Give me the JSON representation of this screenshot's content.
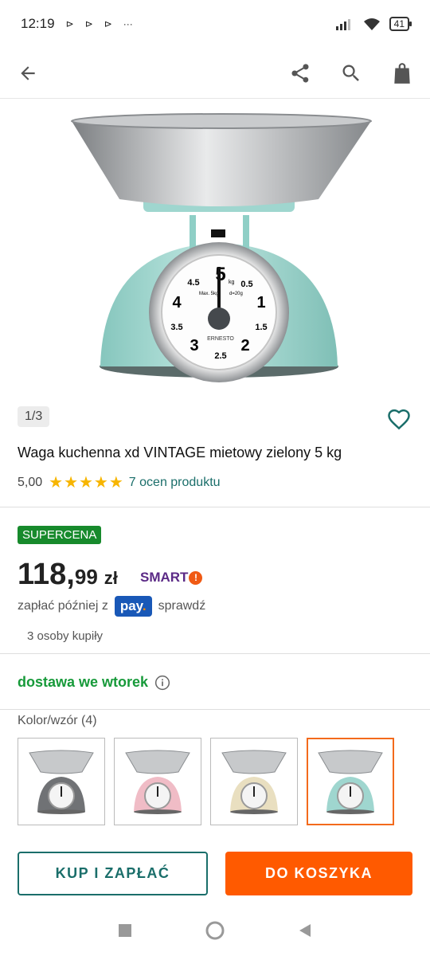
{
  "status_bar": {
    "time": "12:19",
    "notif_glyphs": [
      "⊳",
      "⊳",
      "⊳",
      "···"
    ],
    "battery": "41"
  },
  "app_bar": {
    "back_icon": "arrow-left-icon",
    "share_icon": "share-icon",
    "search_icon": "search-icon",
    "bag_icon": "shopping-bag-icon"
  },
  "gallery": {
    "counter": "1/3",
    "dial_brand": "ERNESTO",
    "dial_numbers": [
      "5",
      "4.5",
      "0.5",
      "4",
      "1",
      "3.5",
      "1.5",
      "3",
      "2",
      "2.5"
    ],
    "dial_small": [
      "kg",
      "Max. 5kg",
      "d=20g"
    ]
  },
  "product": {
    "title": "Waga kuchenna xd VINTAGE mietowy zielony 5 kg",
    "rating_value": "5,00",
    "stars": "★★★★★",
    "reviews_link": "7 ocen produktu"
  },
  "pricing": {
    "badge": "SUPERCENA",
    "price_int": "118,",
    "price_dec": "99",
    "currency": "zł",
    "smart_label": "SMART",
    "smart_mark": "!",
    "pay_later_prefix": "zapłać później z",
    "pay_logo_main": "pay",
    "pay_logo_dot": ".",
    "pay_later_suffix": "sprawdź",
    "bought": "3 osoby kupiły"
  },
  "delivery": {
    "text": "dostawa we wtorek"
  },
  "variants": {
    "label": "Kolor/wzór (4)",
    "colors": [
      "#707275",
      "#f0bcc6",
      "#e9dfc0",
      "#9fd6cf"
    ],
    "selected_index": 3
  },
  "buttons": {
    "buy_now": "KUP I ZAPŁAĆ",
    "add_to_cart": "DO KOSZYKA"
  },
  "colors": {
    "accent_teal": "#1a6e6a",
    "primary_orange": "#ff5a00",
    "badge_green": "#178a2c",
    "star_yellow": "#f7b500"
  }
}
